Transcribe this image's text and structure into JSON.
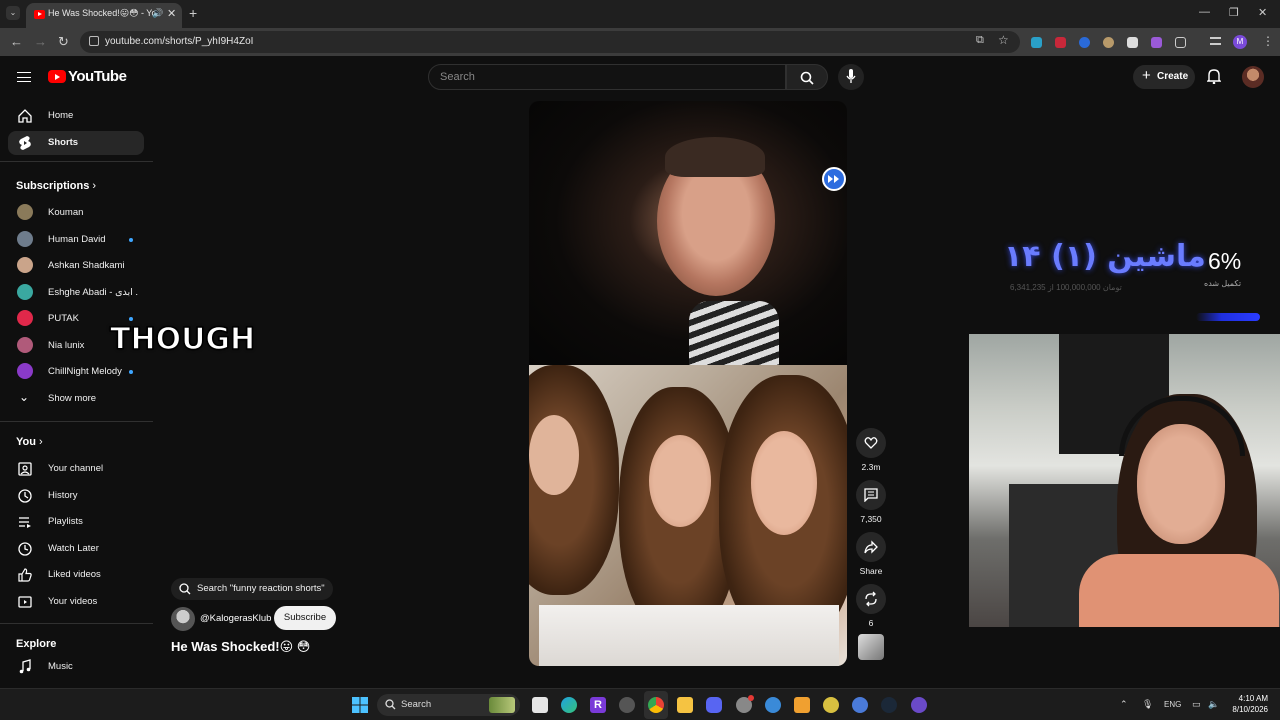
{
  "browser": {
    "tab_title": "He Was Shocked!😛😳 - Yo",
    "tab_audio": "🔊",
    "close": "✕",
    "new_tab": "+",
    "url": "youtube.com/shorts/P_yhI9H4ZoI",
    "win_min": "—",
    "win_restore": "❐",
    "win_close": "✕",
    "profile_initial": "M"
  },
  "header": {
    "logo_text": "YouTube",
    "search_placeholder": "Search",
    "create_label": "Create"
  },
  "sidebar": {
    "main": [
      {
        "label": "Home",
        "icon": "home-icon"
      },
      {
        "label": "Shorts",
        "icon": "shorts-icon",
        "active": true
      }
    ],
    "subscriptions_heading": "Subscriptions",
    "subscriptions": [
      {
        "label": "Kouman",
        "dot": false,
        "color": "#8a7a5a"
      },
      {
        "label": "Human David",
        "dot": true,
        "color": "#6e7c8c"
      },
      {
        "label": "Ashkan Shadkami",
        "dot": false,
        "color": "#caa48a"
      },
      {
        "label": "Eshghe Abadi - ابدی ...",
        "dot": false,
        "color": "#3aa8a0"
      },
      {
        "label": "PUTAK",
        "dot": true,
        "color": "#e0284a"
      },
      {
        "label": "Nia lunix",
        "dot": false,
        "color": "#b05a7a"
      },
      {
        "label": "ChillNight Melody",
        "dot": true,
        "color": "#8a3ac8"
      }
    ],
    "show_more": "Show more",
    "you_heading": "You",
    "you_items": [
      {
        "label": "Your channel",
        "icon": "channel-icon"
      },
      {
        "label": "History",
        "icon": "history-icon"
      },
      {
        "label": "Playlists",
        "icon": "playlists-icon"
      },
      {
        "label": "Watch Later",
        "icon": "clock-icon"
      },
      {
        "label": "Liked videos",
        "icon": "thumbs-up-icon"
      },
      {
        "label": "Your videos",
        "icon": "video-icon"
      }
    ],
    "explore_heading": "Explore",
    "explore_items": [
      {
        "label": "Music",
        "icon": "music-icon"
      }
    ]
  },
  "short": {
    "caption": "THOUGH",
    "likes": "2.3m",
    "comments": "7,350",
    "share": "Share",
    "remix": "6",
    "suggestion": "Search \"funny reaction shorts\"",
    "channel": "@KalogerasKlub",
    "subscribe": "Subscribe",
    "title": "He Was Shocked!😛 😳"
  },
  "overlay": {
    "percent": "6%",
    "percent_label": "تکمیل شده",
    "title_fa": "ماشین (۱) ۱۴",
    "subtitle_fa": "تومان 100,000,000 از 6,341,235"
  },
  "taskbar": {
    "search_label": "Search",
    "lang": "ENG",
    "time": "4:10 AM",
    "date": "8/10/2026"
  },
  "colors": {
    "yt_red": "#ff0000",
    "accent_blue": "#3ea6ff",
    "overlay_blue": "#2a3cff"
  }
}
